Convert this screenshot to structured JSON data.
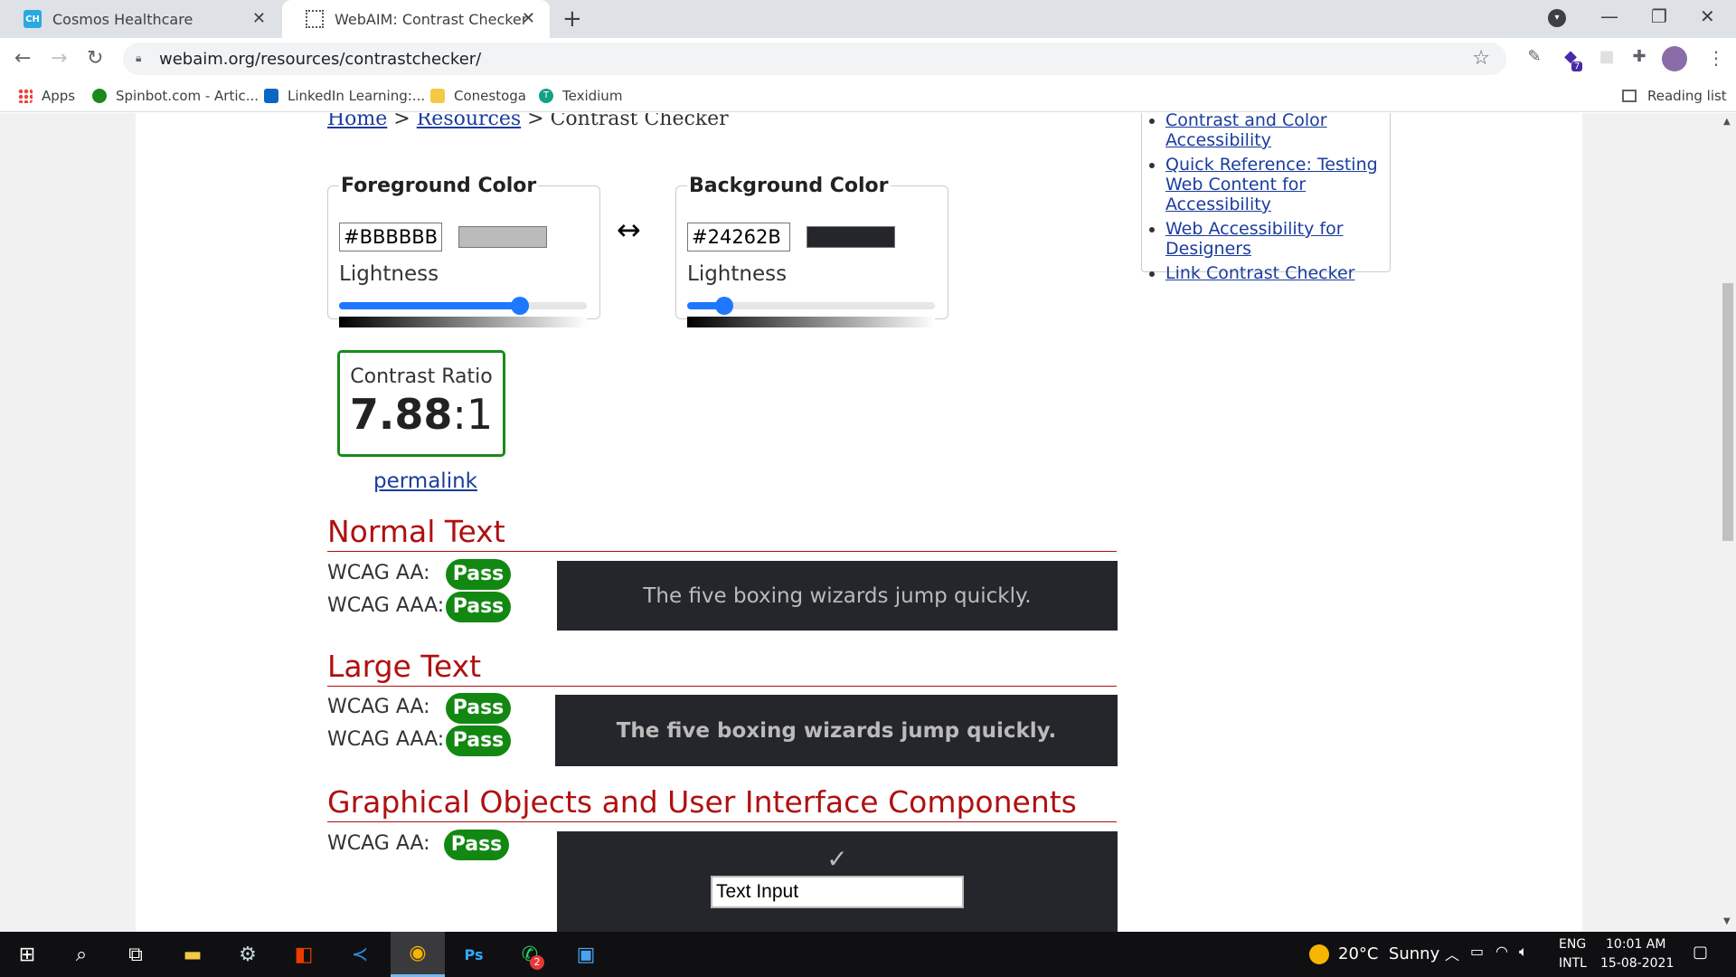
{
  "browser": {
    "tabs": [
      {
        "title": "Cosmos Healthcare",
        "icon_text": "CH"
      },
      {
        "title": "WebAIM: Contrast Checker"
      }
    ],
    "url": "webaim.org/resources/contrastchecker/",
    "bookmarks": [
      {
        "label": "Apps"
      },
      {
        "label": "Spinbot.com - Artic..."
      },
      {
        "label": "LinkedIn Learning:..."
      },
      {
        "label": "Conestoga"
      },
      {
        "label": "Texidium",
        "icon_text": "T"
      }
    ],
    "reading_list": "Reading list",
    "extension_badge": "7"
  },
  "breadcrumb": {
    "home": "Home",
    "sep1": " > ",
    "resources": "Resources",
    "sep2": " > ",
    "current": "Contrast Checker"
  },
  "foreground": {
    "legend": "Foreground Color",
    "hex": "#BBBBBB",
    "color": "#bbbbbb",
    "lightness_label": "Lightness",
    "lightness_value": 0.73
  },
  "background": {
    "legend": "Background Color",
    "hex": "#24262B",
    "color": "#24262b",
    "lightness_label": "Lightness",
    "lightness_value": 0.15
  },
  "swap_symbol": "↔",
  "contrast": {
    "label": "Contrast Ratio",
    "value": "7.88",
    "suffix": ":1",
    "permalink": "permalink"
  },
  "normal_text": {
    "title": "Normal Text",
    "aa_label": "WCAG AA:",
    "aa_result": "Pass",
    "aaa_label": "WCAG AAA:",
    "aaa_result": "Pass",
    "sample": "The five boxing wizards jump quickly."
  },
  "large_text": {
    "title": "Large Text",
    "aa_label": "WCAG AA:",
    "aa_result": "Pass",
    "aaa_label": "WCAG AAA:",
    "aaa_result": "Pass",
    "sample": "The five boxing wizards jump quickly."
  },
  "graphical": {
    "title": "Graphical Objects and User Interface Components",
    "aa_label": "WCAG AA:",
    "aa_result": "Pass",
    "check": "✓",
    "input_value": "Text Input"
  },
  "sidebar_links": [
    "Contrast and Color Accessibility",
    "Quick Reference: Testing Web Content for Accessibility",
    "Web Accessibility for Designers",
    "Link Contrast Checker"
  ],
  "taskbar": {
    "weather": "20°C  Sunny",
    "lang1": "ENG",
    "lang2": "INTL",
    "time": "10:01 AM",
    "date": "15-08-2021",
    "whatsapp_badge": "2"
  },
  "colors": {
    "pass_green": "#128812",
    "heading_red": "#b01010",
    "link_blue": "#1a3c9d",
    "slider_blue": "#1e78ff"
  }
}
